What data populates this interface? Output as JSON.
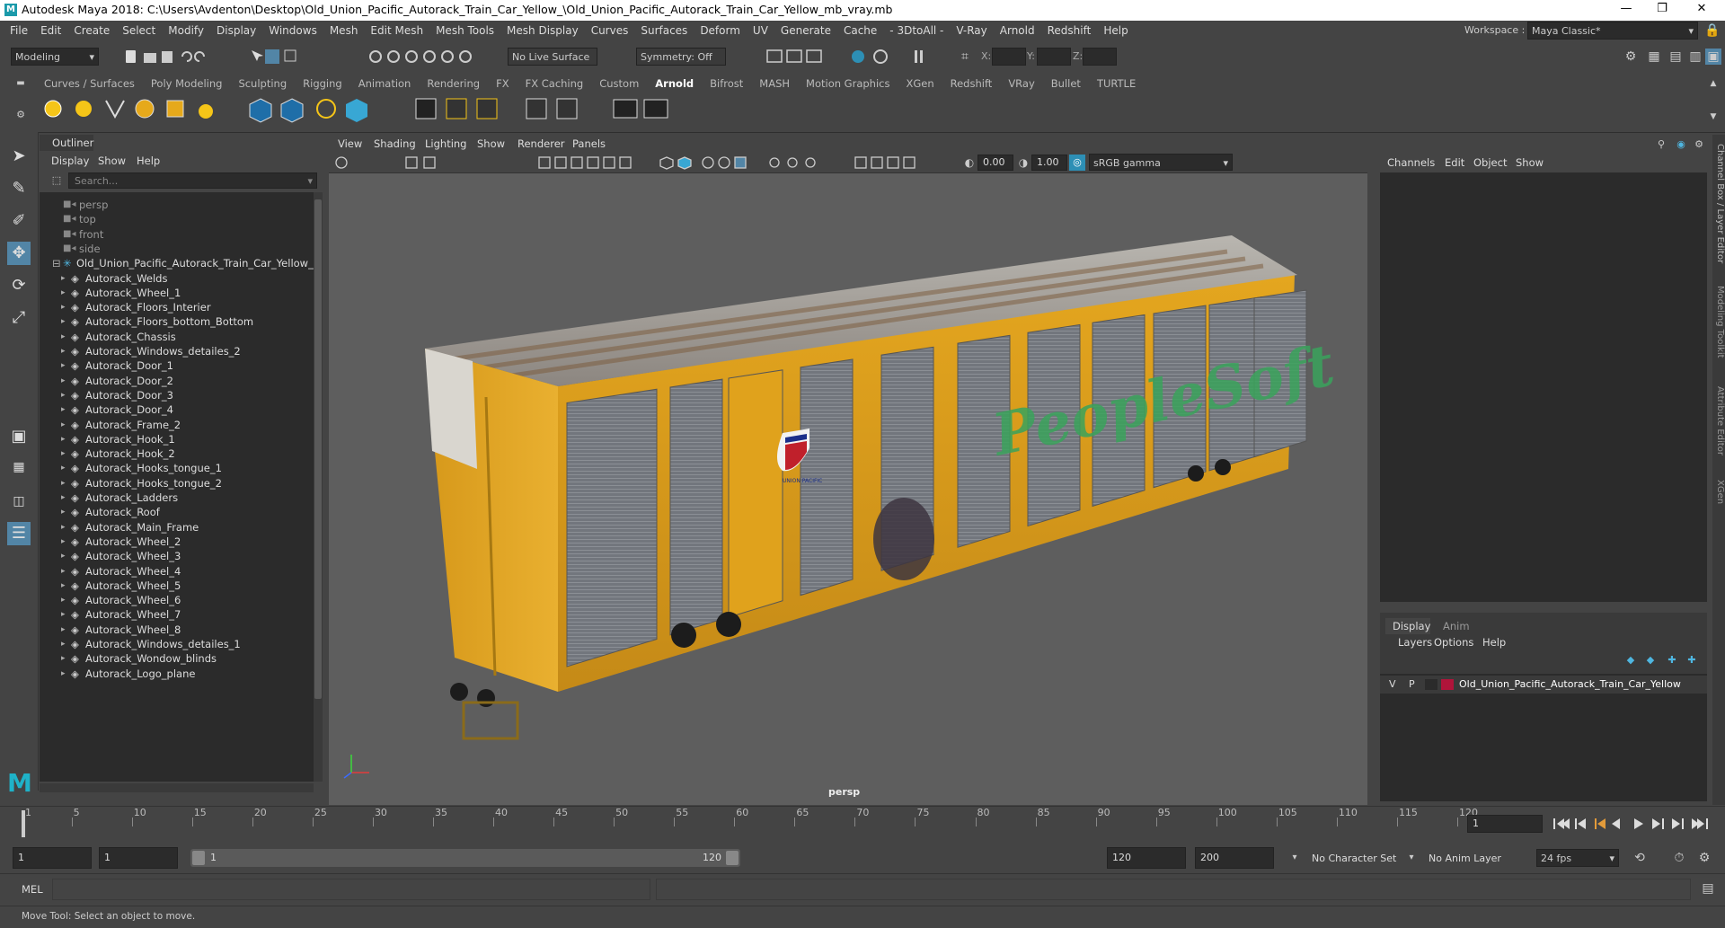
{
  "window": {
    "title": "Autodesk Maya 2018: C:\\Users\\Avdenton\\Desktop\\Old_Union_Pacific_Autorack_Train_Car_Yellow_\\Old_Union_Pacific_Autorack_Train_Car_Yellow_mb_vray.mb"
  },
  "menubar": [
    "File",
    "Edit",
    "Create",
    "Select",
    "Modify",
    "Display",
    "Windows",
    "Mesh",
    "Edit Mesh",
    "Mesh Tools",
    "Mesh Display",
    "Curves",
    "Surfaces",
    "Deform",
    "UV",
    "Generate",
    "Cache",
    "- 3DtoAll -",
    "V-Ray",
    "Arnold",
    "Redshift",
    "Help"
  ],
  "workspace": {
    "label": "Workspace :",
    "value": "Maya Classic*"
  },
  "statusline": {
    "mode": "Modeling",
    "live_surface": "No Live Surface",
    "symmetry": "Symmetry: Off",
    "x_label": "X:",
    "y_label": "Y:",
    "z_label": "Z:"
  },
  "shelf_tabs": [
    "Curves / Surfaces",
    "Poly Modeling",
    "Sculpting",
    "Rigging",
    "Animation",
    "Rendering",
    "FX",
    "FX Caching",
    "Custom",
    "Arnold",
    "Bifrost",
    "MASH",
    "Motion Graphics",
    "XGen",
    "Redshift",
    "VRay",
    "Bullet",
    "TURTLE"
  ],
  "shelf_active": "Arnold",
  "outliner": {
    "title": "Outliner",
    "menus": [
      "Display",
      "Show",
      "Help"
    ],
    "search_placeholder": "Search...",
    "cameras": [
      "persp",
      "top",
      "front",
      "side"
    ],
    "root": "Old_Union_Pacific_Autorack_Train_Car_Yellow_",
    "children": [
      "Autorack_Welds",
      "Autorack_Wheel_1",
      "Autorack_Floors_Interier",
      "Autorack_Floors_bottom_Bottom",
      "Autorack_Chassis",
      "Autorack_Windows_detailes_2",
      "Autorack_Door_1",
      "Autorack_Door_2",
      "Autorack_Door_3",
      "Autorack_Door_4",
      "Autorack_Frame_2",
      "Autorack_Hook_1",
      "Autorack_Hook_2",
      "Autorack_Hooks_tongue_1",
      "Autorack_Hooks_tongue_2",
      "Autorack_Ladders",
      "Autorack_Roof",
      "Autorack_Main_Frame",
      "Autorack_Wheel_2",
      "Autorack_Wheel_3",
      "Autorack_Wheel_4",
      "Autorack_Wheel_5",
      "Autorack_Wheel_6",
      "Autorack_Wheel_7",
      "Autorack_Wheel_8",
      "Autorack_Windows_detailes_1",
      "Autorack_Wondow_blinds",
      "Autorack_Logo_plane"
    ]
  },
  "viewport": {
    "menus": [
      "View",
      "Shading",
      "Lighting",
      "Show",
      "Renderer",
      "Panels"
    ],
    "exposure": "0.00",
    "gamma": "1.00",
    "color_space": "sRGB gamma",
    "camera_label": "persp",
    "graffiti": "PeopleSoft",
    "logo_text": "UNION PACIFIC"
  },
  "channel_box": {
    "menus": [
      "Channels",
      "Edit",
      "Object",
      "Show"
    ],
    "side_tabs": [
      "Channel Box / Layer Editor",
      "Modeling Toolkit",
      "Attribute Editor",
      "XGen"
    ]
  },
  "layer_editor": {
    "tabs": [
      "Display",
      "Anim"
    ],
    "menus": [
      "Layers",
      "Options",
      "Help"
    ],
    "layer": {
      "v": "V",
      "p": "P",
      "name": "Old_Union_Pacific_Autorack_Train_Car_Yellow",
      "color": "#b0143a"
    }
  },
  "timeline": {
    "ticks": [
      "1",
      "5",
      "10",
      "15",
      "20",
      "25",
      "30",
      "35",
      "40",
      "45",
      "50",
      "55",
      "60",
      "65",
      "70",
      "75",
      "80",
      "85",
      "90",
      "95",
      "100",
      "105",
      "110",
      "115",
      "120"
    ],
    "current_frame": "1"
  },
  "range": {
    "start": "1",
    "anim_start": "1",
    "slider_start": "1",
    "slider_end": "120",
    "end": "120",
    "anim_end": "200",
    "character_set": "No Character Set",
    "anim_layer": "No Anim Layer",
    "fps": "24 fps"
  },
  "cmdline": {
    "label": "MEL"
  },
  "helpline": {
    "text": "Move Tool: Select an object to move."
  },
  "colors": {
    "accent": "#5285a6",
    "car_yellow": "#e0a21c",
    "bg_dark": "#2b2b2b"
  }
}
